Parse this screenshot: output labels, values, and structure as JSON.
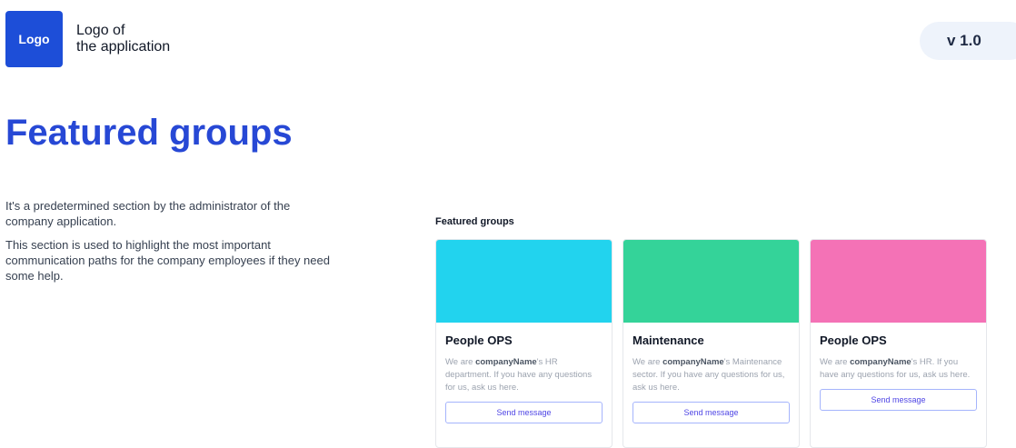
{
  "header": {
    "logo_label": "Logo",
    "logo_caption_line1": "Logo of",
    "logo_caption_line2": "the application",
    "version": "v 1.0"
  },
  "page": {
    "title": "Featured groups",
    "intro_p1": "It's a predetermined section by the administrator of the company application.",
    "intro_p2": "This section is used to highlight the most important communication paths for the company employees if they need some help."
  },
  "featured": {
    "label": "Featured groups",
    "cards": [
      {
        "title": "People OPS",
        "desc_pre": "We are ",
        "desc_company": "companyName",
        "desc_post": "'s HR department. If you have any questions for us, ask us here.",
        "button": "Send message",
        "color": "#22d3ee"
      },
      {
        "title": "Maintenance",
        "desc_pre": "We are ",
        "desc_company": "companyName",
        "desc_post": "'s Maintenance sector. If you have any questions for us, ask us here.",
        "button": "Send message",
        "color": "#34d399"
      },
      {
        "title": "People OPS",
        "desc_pre": "We are ",
        "desc_company": "companyName",
        "desc_post": "'s HR. If you have any questions for us, ask us here.",
        "button": "Send message",
        "color": "#f472b6"
      }
    ]
  }
}
